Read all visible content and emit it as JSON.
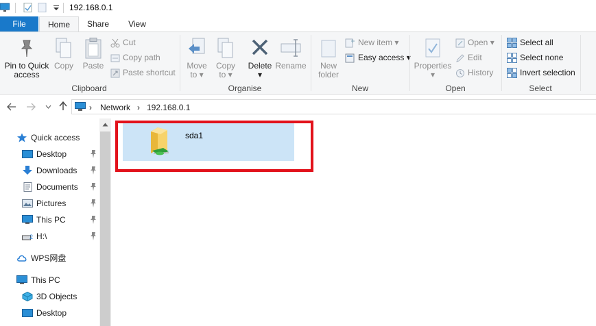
{
  "window": {
    "title": "192.168.0.1",
    "quick_access_icons": [
      "computer-icon",
      "properties-icon",
      "new-folder-icon",
      "customize-dropdown-icon"
    ]
  },
  "tabs": [
    {
      "label": "File",
      "active": false
    },
    {
      "label": "Home",
      "active": true
    },
    {
      "label": "Share",
      "active": false
    },
    {
      "label": "View",
      "active": false
    }
  ],
  "ribbon": {
    "clipboard": {
      "label": "Clipboard",
      "pin_label_1": "Pin to Quick",
      "pin_label_2": "access",
      "copy": "Copy",
      "paste": "Paste",
      "cut": "Cut",
      "copy_path": "Copy path",
      "paste_shortcut": "Paste shortcut"
    },
    "organise": {
      "label": "Organise",
      "move_to_1": "Move",
      "move_to_2": "to",
      "copy_to_1": "Copy",
      "copy_to_2": "to",
      "delete": "Delete",
      "rename": "Rename"
    },
    "new": {
      "label": "New",
      "new_folder_1": "New",
      "new_folder_2": "folder",
      "new_item": "New item",
      "easy_access": "Easy access"
    },
    "open": {
      "label": "Open",
      "properties": "Properties",
      "open": "Open",
      "edit": "Edit",
      "history": "History"
    },
    "select": {
      "label": "Select",
      "select_all": "Select all",
      "select_none": "Select none",
      "invert_selection": "Invert selection"
    }
  },
  "address": {
    "crumbs": [
      "Network",
      "192.168.0.1"
    ]
  },
  "nav": {
    "quick_access": "Quick access",
    "items": [
      {
        "label": "Desktop",
        "pinned": true
      },
      {
        "label": "Downloads",
        "pinned": true
      },
      {
        "label": "Documents",
        "pinned": true
      },
      {
        "label": "Pictures",
        "pinned": true
      },
      {
        "label": "This PC",
        "pinned": true
      },
      {
        "label": "H:\\",
        "pinned": true
      }
    ],
    "wps": "WPS网盘",
    "this_pc": "This PC",
    "pc_items": [
      "3D Objects",
      "Desktop"
    ]
  },
  "content": {
    "items": [
      {
        "name": "sda1",
        "selected": true
      }
    ]
  },
  "colors": {
    "file_tab": "#1979ca",
    "selection": "#cce4f7",
    "highlight_box": "#e2121b"
  }
}
